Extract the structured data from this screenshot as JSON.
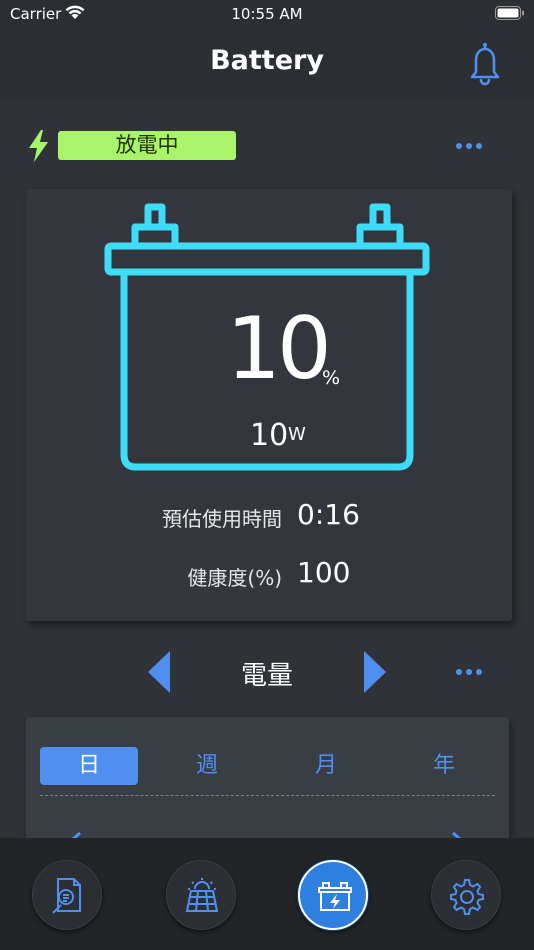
{
  "status_bar": {
    "carrier": "Carrier",
    "time": "10:55 AM"
  },
  "header": {
    "title": "Battery",
    "notification_icon": "bell-icon"
  },
  "battery_state": {
    "label": "放電中",
    "icon": "lightning-bolt-icon",
    "badge_color": "#a8f56a"
  },
  "battery": {
    "percent": "10",
    "percent_unit": "%",
    "power": "10",
    "power_unit": "W",
    "stats": [
      {
        "label": "預估使用時間",
        "value": "0:16"
      },
      {
        "label": "健康度(%)",
        "value": "100"
      }
    ]
  },
  "chart_selector": {
    "label": "電量"
  },
  "period_tabs": {
    "items": [
      "日",
      "週",
      "月",
      "年"
    ],
    "selected": "日"
  },
  "tab_bar": {
    "items": [
      {
        "name": "report-icon"
      },
      {
        "name": "solar-panel-icon"
      },
      {
        "name": "battery-icon",
        "selected": true
      },
      {
        "name": "gear-icon"
      }
    ]
  },
  "colors": {
    "accent": "#4f8ff0",
    "battery_outline": "#3fdcf7",
    "charge_green": "#a8f56a"
  }
}
